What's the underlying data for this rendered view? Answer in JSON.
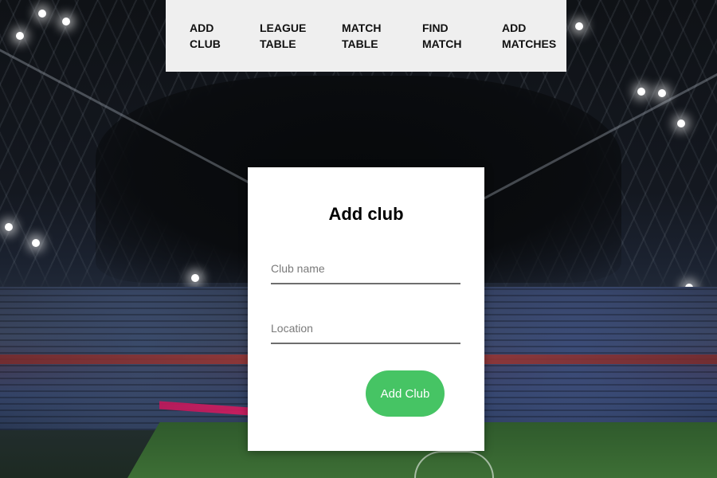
{
  "nav": {
    "items": [
      {
        "label": "ADD\nCLUB"
      },
      {
        "label": "LEAGUE\nTABLE"
      },
      {
        "label": "MATCH\nTABLE"
      },
      {
        "label": "FIND\nMATCH"
      },
      {
        "label": "ADD\nMATCHES"
      }
    ]
  },
  "form": {
    "title": "Add club",
    "club_name": {
      "placeholder": "Club name",
      "value": ""
    },
    "location": {
      "placeholder": "Location",
      "value": ""
    },
    "submit_label": "Add Club",
    "submit_color": "#46c464"
  },
  "background": {
    "description_icon": "stadium-image"
  }
}
